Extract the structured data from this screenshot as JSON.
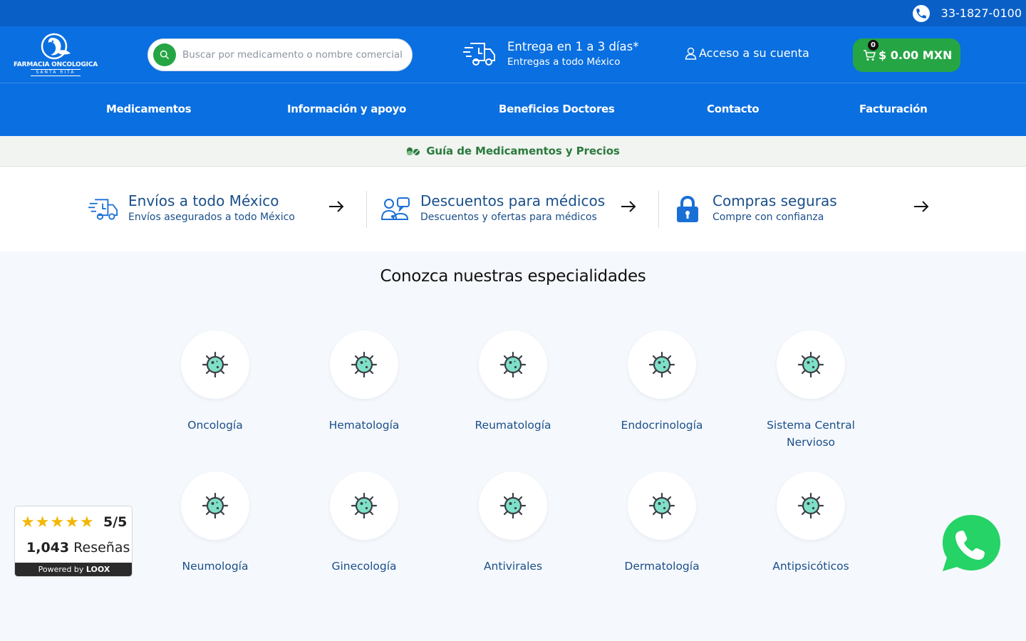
{
  "topbar": {
    "phone": "33-1827-0100"
  },
  "header": {
    "logo_name": "FARMACIA ONCOLOGICA",
    "logo_sub": "SANTA RITA",
    "search_placeholder": "Buscar por medicamento o nombre comercial",
    "delivery_title": "Entrega en 1 a 3 días*",
    "delivery_sub": "Entregas a todo México",
    "account_label": "Acceso a su cuenta",
    "cart_count": "0",
    "cart_total": "$ 0.00 MXN"
  },
  "nav": {
    "items": [
      "Medicamentos",
      "Información y apoyo",
      "Beneficios Doctores",
      "Contacto",
      "Facturación"
    ]
  },
  "guide": {
    "label": "Guía de Medicamentos y Precios"
  },
  "features": [
    {
      "title": "Envíos a todo México",
      "subtitle": "Envíos asegurados a todo México"
    },
    {
      "title": "Descuentos para médicos",
      "subtitle": "Descuentos y ofertas para médicos"
    },
    {
      "title": "Compras seguras",
      "subtitle": "Compre con confianza"
    }
  ],
  "specialties": {
    "title": "Conozca nuestras especialidades",
    "items": [
      "Oncología",
      "Hematología",
      "Reumatología",
      "Endocrinología",
      "Sistema Central Nervioso",
      "Neumología",
      "Ginecología",
      "Antivirales",
      "Dermatología",
      "Antipsicóticos"
    ]
  },
  "reviews": {
    "score": "5/5",
    "count": "1,043",
    "count_label": "Reseñas",
    "powered_by": "Powered by",
    "brand": "LOOX"
  },
  "colors": {
    "brand_blue": "#0a6fe0",
    "topbar_blue": "#0a5fc7",
    "accent_green": "#26a544",
    "link_blue": "#1a4f8a"
  }
}
